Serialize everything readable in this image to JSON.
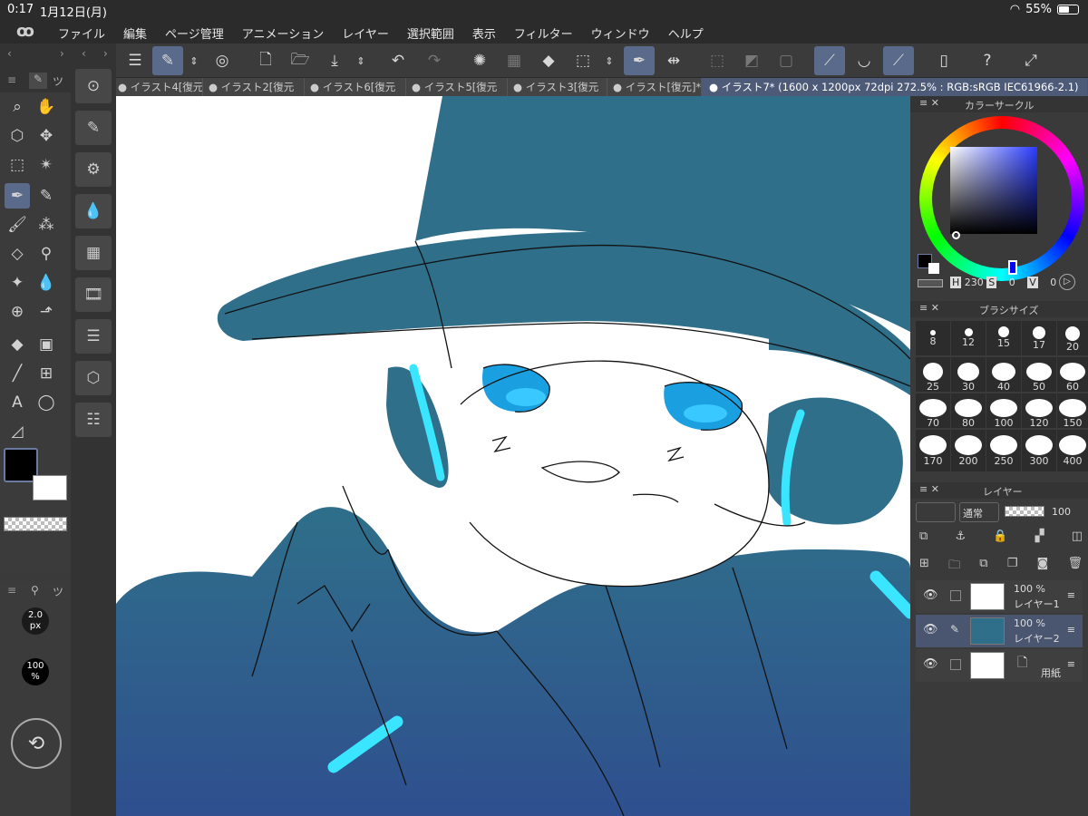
{
  "status": {
    "time": "0:17",
    "date": "1月12日(月)",
    "battery": "55%"
  },
  "menu": [
    "ファイル",
    "編集",
    "ページ管理",
    "アニメーション",
    "レイヤー",
    "選択範囲",
    "表示",
    "フィルター",
    "ウィンドウ",
    "ヘルプ"
  ],
  "tabs": [
    "● イラスト4[復元",
    "● イラスト2[復元",
    "● イラスト6[復元",
    "● イラスト5[復元",
    "● イラスト3[復元",
    "● イラスト[復元]*",
    "● イラスト7* (1600 x 1200px 72dpi 272.5% : RGB:sRGB IEC61966-2.1)"
  ],
  "tool_tab_label": "ツ",
  "subtool": {
    "brush_size": "2.0",
    "brush_unit": "px",
    "opacity": "100",
    "opacity_unit": "%"
  },
  "color_panel": {
    "title": "カラーサークル",
    "h": "230",
    "s": "0",
    "v": "0",
    "h_label": "H",
    "s_label": "S",
    "v_label": "V"
  },
  "brush_panel": {
    "title": "ブラシサイズ",
    "sizes": [
      "8",
      "12",
      "15",
      "17",
      "20",
      "25",
      "30",
      "40",
      "50",
      "60",
      "70",
      "80",
      "100",
      "120",
      "150",
      "170",
      "200",
      "250",
      "300",
      "400"
    ]
  },
  "layer_panel": {
    "title": "レイヤー",
    "blend_mode": "通常",
    "opacity": "100",
    "layers": [
      {
        "pct": "100 %",
        "name": "レイヤー1"
      },
      {
        "pct": "100 %",
        "name": "レイヤー2"
      },
      {
        "pct": "",
        "name": "用紙"
      }
    ]
  },
  "colors": {
    "main": "#000000",
    "sub": "#ffffff",
    "accent": "#5a6a8a",
    "fill_teal": "#2f6f8a",
    "glow": "#39e5ff"
  }
}
